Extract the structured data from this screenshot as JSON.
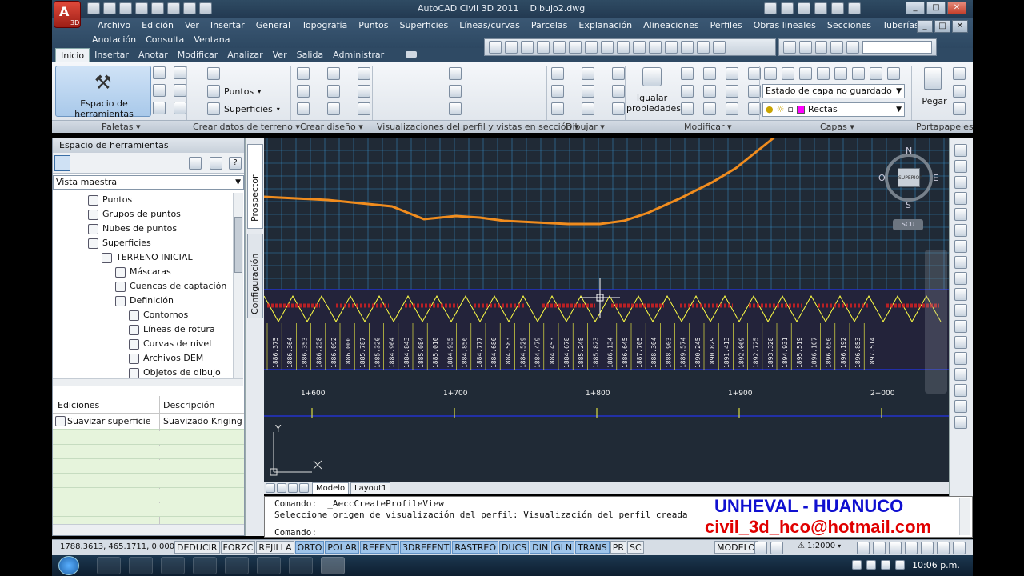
{
  "window": {
    "title": "AutoCAD Civil 3D 2011    Dibujo2.dwg",
    "app_icon_label": "3D"
  },
  "menu": {
    "row1": [
      "Archivo",
      "Edición",
      "Ver",
      "Insertar",
      "General",
      "Topografía",
      "Puntos",
      "Superficies",
      "Líneas/curvas",
      "Parcelas",
      "Explanación",
      "Alineaciones",
      "Perfiles",
      "Obras lineales",
      "Secciones",
      "Tuberías"
    ],
    "row2": [
      "Anotación",
      "Consulta",
      "Ventana"
    ]
  },
  "ribbon_tabs": [
    "Inicio",
    "Insertar",
    "Anotar",
    "Modificar",
    "Analizar",
    "Ver",
    "Salida",
    "Administrar"
  ],
  "ribbon": {
    "toolspace_button": "Espacio de herramientas",
    "points_label": "Puntos",
    "surfaces_label": "Superficies",
    "match_props_label": "Igualar propiedades",
    "layer_state": "Estado de capa no guardado",
    "layer_current": "Rectas",
    "paste_label": "Pegar",
    "groups": [
      "Paletas",
      "Crear datos de terreno",
      "Crear diseño",
      "Visualizaciones del perfil y vistas en sección",
      "Dibujar",
      "Modificar",
      "Capas",
      "Portapapeles"
    ]
  },
  "panel": {
    "title": "Espacio de herramientas",
    "view_select": "Vista maestra",
    "side_tabs": [
      "Prospector",
      "Configuración"
    ],
    "tree": [
      {
        "label": "Puntos",
        "indent": 0
      },
      {
        "label": "Grupos de puntos",
        "indent": 0
      },
      {
        "label": "Nubes de puntos",
        "indent": 0
      },
      {
        "label": "Superficies",
        "indent": 0
      },
      {
        "label": "TERRENO INICIAL",
        "indent": 1
      },
      {
        "label": "Máscaras",
        "indent": 2
      },
      {
        "label": "Cuencas de captación",
        "indent": 2
      },
      {
        "label": "Definición",
        "indent": 2
      },
      {
        "label": "Contornos",
        "indent": 3
      },
      {
        "label": "Líneas de rotura",
        "indent": 3
      },
      {
        "label": "Curvas de nivel",
        "indent": 3
      },
      {
        "label": "Archivos DEM",
        "indent": 3
      },
      {
        "label": "Objetos de dibujo",
        "indent": 3
      }
    ],
    "edits_headers": [
      "Ediciones",
      "Descripción"
    ],
    "edits_rows": [
      [
        "Suavizar superficie",
        "Suavizado Kriging"
      ]
    ]
  },
  "drawing": {
    "compass": {
      "n": "N",
      "s": "S",
      "e": "E",
      "o": "O",
      "center": "SUPERIOR",
      "ucs": "SCU"
    },
    "elevations": [
      "1886.375",
      "1886.364",
      "1886.353",
      "1886.258",
      "1886.092",
      "1886.000",
      "1885.787",
      "1885.320",
      "1884.964",
      "1884.843",
      "1885.084",
      "1885.010",
      "1884.935",
      "1884.856",
      "1884.777",
      "1884.680",
      "1884.583",
      "1884.529",
      "1884.479",
      "1884.453",
      "1884.678",
      "1885.248",
      "1885.823",
      "1886.134",
      "1886.645",
      "1887.705",
      "1888.304",
      "1888.903",
      "1889.574",
      "1890.245",
      "1890.829",
      "1891.413",
      "1892.069",
      "1892.725",
      "1893.328",
      "1894.931",
      "1895.519",
      "1896.107",
      "1896.650",
      "1896.192",
      "1896.853",
      "1897.514"
    ],
    "stations": [
      "1+600",
      "1+700",
      "1+800",
      "1+900",
      "2+000"
    ],
    "axis_y": "Y"
  },
  "layout_tabs": [
    "Modelo",
    "Layout1"
  ],
  "command": {
    "line1": "Comando:  _AeccCreateProfileView",
    "line2": "Seleccione origen de visualización del perfil: Visualización del perfil creada",
    "prompt": "Comando:"
  },
  "watermark": {
    "line1": "UNHEVAL - HUANUCO",
    "line2": "civil_3d_hco@hotmail.com"
  },
  "status": {
    "coords": "1788.3613, 465.1711, 0.0000",
    "toggles": [
      {
        "label": "DEDUCIR",
        "on": false
      },
      {
        "label": "FORZC",
        "on": false
      },
      {
        "label": "REJILLA",
        "on": false
      },
      {
        "label": "ORTO",
        "on": true
      },
      {
        "label": "POLAR",
        "on": true
      },
      {
        "label": "REFENT",
        "on": true
      },
      {
        "label": "3DREFENT",
        "on": true
      },
      {
        "label": "RASTREO",
        "on": true
      },
      {
        "label": "DUCS",
        "on": true
      },
      {
        "label": "DIN",
        "on": true
      },
      {
        "label": "GLN",
        "on": true
      },
      {
        "label": "TRANS",
        "on": true
      },
      {
        "label": "PR",
        "on": false
      },
      {
        "label": "SC",
        "on": false
      }
    ],
    "model_label": "MODELO",
    "scale": "1:2000"
  },
  "taskbar": {
    "clock": "10:06 p.m."
  },
  "colors": {
    "profile": "#f08c1e",
    "grid": "#3b9fe0",
    "band": "#ffff44",
    "labels_red": "#e02020"
  }
}
